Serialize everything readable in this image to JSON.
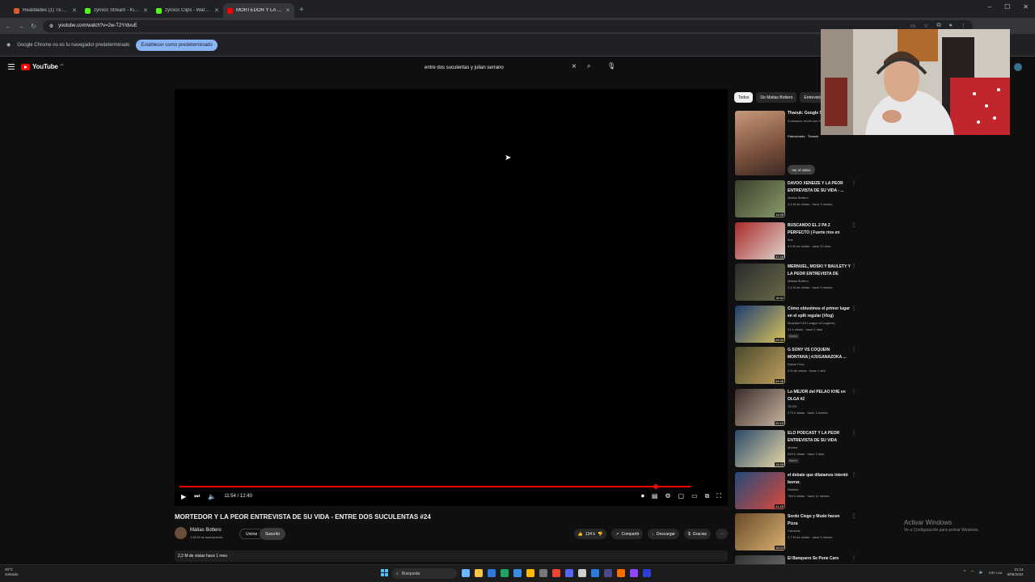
{
  "browser": {
    "tabs": [
      {
        "title": "Realidades (1) TER - youtube.com",
        "color": "#e05a2b",
        "active": false
      },
      {
        "title": "zynxcc Stream - Kick Dashboa",
        "color": "#53fc18",
        "active": false
      },
      {
        "title": "zynxcc Clips - Watch Live on K",
        "color": "#53fc18",
        "active": false
      },
      {
        "title": "MORTEDOR Y LA PEOR ENTREV",
        "color": "#ff0000",
        "active": true
      }
    ],
    "new_tab": "+",
    "url": "youtube.com/watch?v=2w-T2Y/dvuE",
    "infobar_text": "Google Chrome no es tu navegador predeterminado",
    "infobar_button": "Establecer como predeterminado"
  },
  "youtube": {
    "logo_text": "YouTube",
    "logo_country": "ES",
    "search_value": "entre dos suculentas y julian serrano"
  },
  "player": {
    "time": "11:54 / 12:40",
    "progress_fraction": 0.94
  },
  "video": {
    "title": "MORTEDOR Y LA PEOR ENTREVISTA DE SU VIDA - ENTRE DOS SUCULENTAS #24",
    "channel": "Matias Bottero",
    "subscribers": "1,48 M de suscriptores",
    "join": "Unirse",
    "subscribed": "Suscrito",
    "likes": "134 k",
    "share": "Compartir",
    "download": "Descargar",
    "thanks": "Gracias",
    "more": "···",
    "meta": "2,2 M de vistas hace 1 mes"
  },
  "sidebar": {
    "chips": [
      "Todos",
      "De Matias Bottero",
      "Entrevistas"
    ],
    "ad": {
      "title": "Thanuk: Google S",
      "description": "A amazon, envíe con Google Smart, mejore sus",
      "sponsored": "Patrocinado · Thanuk",
      "button": "Ver el video"
    },
    "recommendations": [
      {
        "title": "DAVOO XENEIZE Y LA PEOR ENTREVISTA DE SU VIDA - ...",
        "channel": "Matias Bottero",
        "meta": "2,4 M de vistas · hace 3 meses",
        "duration": "14:05",
        "thumb": [
          "#3a3f2c",
          "#8a9a6a"
        ]
      },
      {
        "title": "BUSCANDO EL 2 PA 2 PERFECTO | Fuerte ríos en",
        "channel": "Ibai",
        "meta": "6,9 M de vistas · hace 10 días",
        "duration": "37:28",
        "thumb": [
          "#a82a2a",
          "#e0d6cf"
        ]
      },
      {
        "title": "MERNUEL, MOSKI Y BAULETY Y LA PEOR ENTREVISTA DE SUS...",
        "channel": "Matias Bottero",
        "meta": "1,1 M de vistas · hace 3 meses",
        "duration": "18:54",
        "thumb": [
          "#2a2a2a",
          "#6a6a4a"
        ]
      },
      {
        "title": "Cómo obtuvimos el primer lugar en el split regular (Vlog)",
        "channel": "Movistar KOI League of Legends",
        "meta": "21 k vistas · hace 2 días",
        "duration": "29:30",
        "badge": "Nuevo",
        "thumb": [
          "#1d3c70",
          "#d9c25a"
        ]
      },
      {
        "title": "G SONY VS COQUEIN MONTANA | #JUGANAZOKA ...",
        "channel": "Elaine Fera",
        "meta": "3 M de vistas · hace 1 año",
        "duration": "54:06",
        "thumb": [
          "#4a4a2a",
          "#c0a060"
        ]
      },
      {
        "title": "Lo MEJOR del PELAO KHE en OLGA #2",
        "channel": "OLGA",
        "meta": "273 k vistas · hace 3 meses",
        "duration": "20:19",
        "thumb": [
          "#3a2c2a",
          "#c8b6a0"
        ]
      },
      {
        "title": "ELO PODCAST Y LA PEOR ENTREVISTA DE SU VIDA",
        "channel": "Mortee",
        "meta": "249 k vistas · hace 3 días",
        "duration": "15:26",
        "badge": "Nuevo",
        "thumb": [
          "#2c4a6a",
          "#e8d8a8"
        ]
      },
      {
        "title": "el debate que dilatamos intentó borrar.",
        "channel": "Rewind",
        "meta": "769 k vistas · hace 11 meses",
        "duration": "41:26",
        "thumb": [
          "#234a7a",
          "#d84a3a"
        ]
      },
      {
        "title": "Sordo Ciego y Mudo hacen Pizza",
        "channel": "Carreras",
        "meta": "2,7 M de vistas · hace 3 meses",
        "duration": "16:03",
        "thumb": [
          "#6a4a2a",
          "#d8b070"
        ]
      },
      {
        "title": "El Banquero Se Pone Caro",
        "channel": "",
        "meta": "",
        "duration": "",
        "thumb": [
          "#333",
          "#777"
        ]
      }
    ]
  },
  "os": {
    "watermark_title": "Activar Windows",
    "watermark_sub": "Ve a Configuración para activar Windows.",
    "weather_temp": "28°C",
    "weather_desc": "Soleado",
    "taskbar_search": "Búsqueda",
    "language": "ESP LAA",
    "time": "21:14",
    "date": "8/06/2024",
    "taskbar_apps": [
      "#6ab7ff",
      "#f4c542",
      "#2d7be0",
      "#1fa463",
      "#3a8ee6",
      "#ffb900",
      "#777",
      "#ea4335",
      "#5865f2",
      "#cfcfcf",
      "#2d7be0",
      "#4a4a8a",
      "#ff6a00",
      "#9146ff",
      "#2d3fd6"
    ]
  },
  "colors": {
    "accent": "#ff0000",
    "background": "#0f0f0f"
  }
}
